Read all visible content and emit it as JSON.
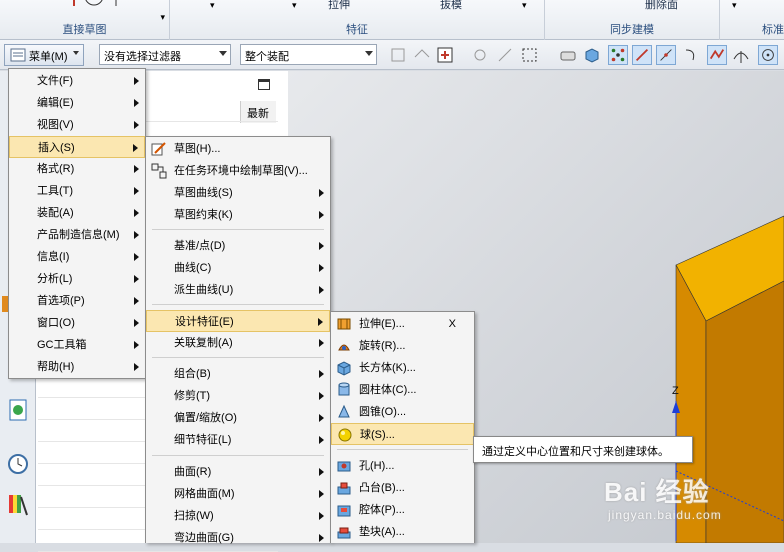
{
  "ribbon": {
    "groups": [
      {
        "label": "直接草图"
      },
      {
        "label": "特征"
      },
      {
        "label": "同步建模"
      },
      {
        "label": "标准"
      }
    ],
    "partial_buttons": [
      "拉伸",
      "抜模",
      "删除面"
    ]
  },
  "toolbar": {
    "menu_label": "菜单(M)",
    "filter_value": "没有选择过滤器",
    "assembly_value": "整个装配"
  },
  "nav_panel": {
    "column_header": "最新"
  },
  "main_menu": {
    "items": [
      {
        "label": "文件(F)",
        "has_sub": true
      },
      {
        "label": "编辑(E)",
        "has_sub": true
      },
      {
        "label": "视图(V)",
        "has_sub": true
      },
      {
        "label": "插入(S)",
        "has_sub": true,
        "highlighted": true
      },
      {
        "label": "格式(R)",
        "has_sub": true
      },
      {
        "label": "工具(T)",
        "has_sub": true
      },
      {
        "label": "装配(A)",
        "has_sub": true
      },
      {
        "label": "产品制造信息(M)",
        "has_sub": true
      },
      {
        "label": "信息(I)",
        "has_sub": true
      },
      {
        "label": "分析(L)",
        "has_sub": true
      },
      {
        "label": "首选项(P)",
        "has_sub": true
      },
      {
        "label": "窗口(O)",
        "has_sub": true
      },
      {
        "label": "GC工具箱",
        "has_sub": true
      },
      {
        "label": "帮助(H)",
        "has_sub": true
      }
    ]
  },
  "insert_menu": {
    "items": [
      {
        "label": "草图(H)...",
        "icon": "sketch-icon"
      },
      {
        "label": "在任务环境中绘制草图(V)...",
        "icon": "task-sketch-icon"
      },
      {
        "label": "草图曲线(S)",
        "has_sub": true
      },
      {
        "label": "草图约束(K)",
        "has_sub": true
      },
      {
        "label": "基准/点(D)",
        "has_sub": true
      },
      {
        "label": "曲线(C)",
        "has_sub": true
      },
      {
        "label": "派生曲线(U)",
        "has_sub": true
      },
      {
        "label": "设计特征(E)",
        "has_sub": true,
        "highlighted": true
      },
      {
        "label": "关联复制(A)",
        "has_sub": true
      },
      {
        "label": "组合(B)",
        "has_sub": true
      },
      {
        "label": "修剪(T)",
        "has_sub": true
      },
      {
        "label": "偏置/缩放(O)",
        "has_sub": true
      },
      {
        "label": "细节特征(L)",
        "has_sub": true
      },
      {
        "label": "曲面(R)",
        "has_sub": true
      },
      {
        "label": "网格曲面(M)",
        "has_sub": true
      },
      {
        "label": "扫掠(W)",
        "has_sub": true
      },
      {
        "label": "弯边曲面(G)",
        "has_sub": true
      }
    ]
  },
  "design_feature_menu": {
    "items": [
      {
        "label": "拉伸(E)...",
        "shortcut": "X",
        "icon": "extrude-icon"
      },
      {
        "label": "旋转(R)...",
        "icon": "revolve-icon"
      },
      {
        "label": "长方体(K)...",
        "icon": "block-icon"
      },
      {
        "label": "圆柱体(C)...",
        "icon": "cylinder-icon"
      },
      {
        "label": "圆锥(O)...",
        "icon": "cone-icon"
      },
      {
        "label": "球(S)...",
        "icon": "sphere-icon",
        "highlighted": true
      },
      {
        "label": "孔(H)...",
        "icon": "hole-icon"
      },
      {
        "label": "凸台(B)...",
        "icon": "boss-icon"
      },
      {
        "label": "腔体(P)...",
        "icon": "pocket-icon"
      },
      {
        "label": "垫块(A)...",
        "icon": "pad-icon"
      }
    ]
  },
  "tooltip": {
    "text": "通过定义中心位置和尺寸来创建球体。"
  },
  "viewport": {
    "axis_label": "Z",
    "solid_color": "#c27a00",
    "solid_top_color": "#f2b200"
  },
  "watermark": {
    "brand": "Bai 经验",
    "url": "jingyan.baidu.com"
  }
}
